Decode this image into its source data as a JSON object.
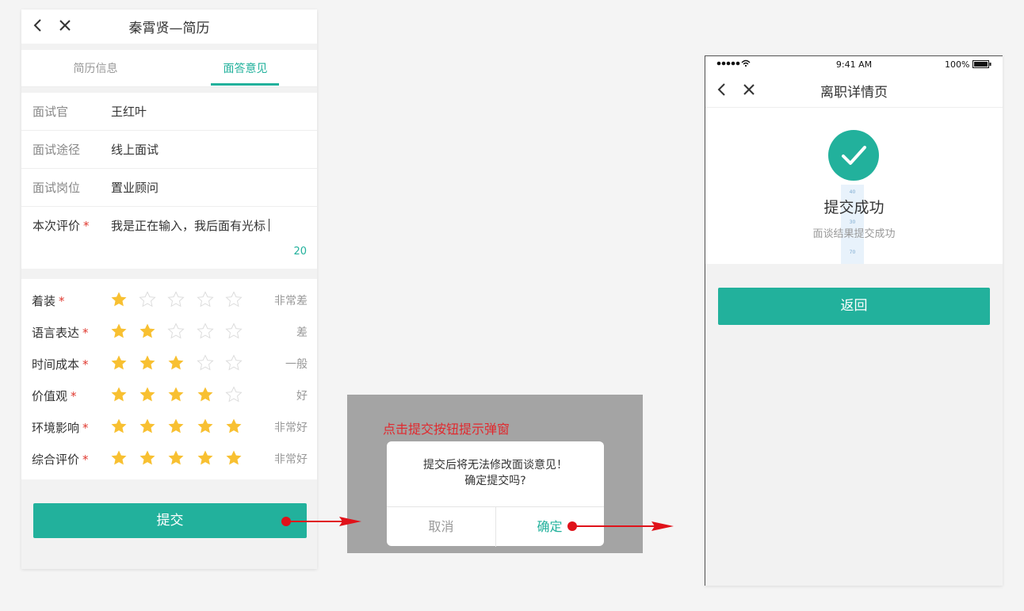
{
  "left_phone": {
    "title": "秦霄贤—简历",
    "tabs": [
      {
        "label": "简历信息",
        "active": false
      },
      {
        "label": "面答意见",
        "active": true
      }
    ],
    "fields": [
      {
        "label": "面试官",
        "value": "王红叶"
      },
      {
        "label": "面试途径",
        "value": "线上面试"
      },
      {
        "label": "面试岗位",
        "value": "置业顾问"
      }
    ],
    "evaluation": {
      "label": "本次评价",
      "required_mark": "*",
      "value": "我是正在输入，我后面有光标",
      "count": "20"
    },
    "ratings": [
      {
        "label": "着装",
        "required_mark": "*",
        "stars": 1,
        "text": "非常差"
      },
      {
        "label": "语言表达",
        "required_mark": "*",
        "stars": 2,
        "text": "差"
      },
      {
        "label": "时间成本",
        "required_mark": "*",
        "stars": 3,
        "text": "一般"
      },
      {
        "label": "价值观",
        "required_mark": "*",
        "stars": 4,
        "text": "好"
      },
      {
        "label": "环境影响",
        "required_mark": "*",
        "stars": 5,
        "text": "非常好"
      },
      {
        "label": "综合评价",
        "required_mark": "*",
        "stars": 5,
        "text": "非常好"
      }
    ],
    "max_stars": 5,
    "submit_label": "提交"
  },
  "dialog_mock": {
    "annotation": "点击提交按钮提示弹窗",
    "message_line1": "提交后将无法修改面谈意见！",
    "message_line2": "确定提交吗?",
    "cancel_label": "取消",
    "confirm_label": "确定"
  },
  "right_phone": {
    "status_time": "9:41 AM",
    "status_battery": "100%",
    "title": "离职详情页",
    "success_title": "提交成功",
    "success_subtitle": "面谈结果提交成功",
    "ruler_marks": [
      "40",
      "30",
      "70"
    ],
    "back_label": "返回"
  },
  "colors": {
    "accent": "#22b19c",
    "star": "#f8c031",
    "star_empty": "#dddddd",
    "required": "#e0392f",
    "annotation": "#e0292e",
    "arrow": "#e0121a",
    "overlay": "#a4a4a4"
  },
  "icons": [
    "back-icon",
    "close-icon",
    "star-icon",
    "checkmark-icon",
    "wifi-icon",
    "battery-icon"
  ]
}
